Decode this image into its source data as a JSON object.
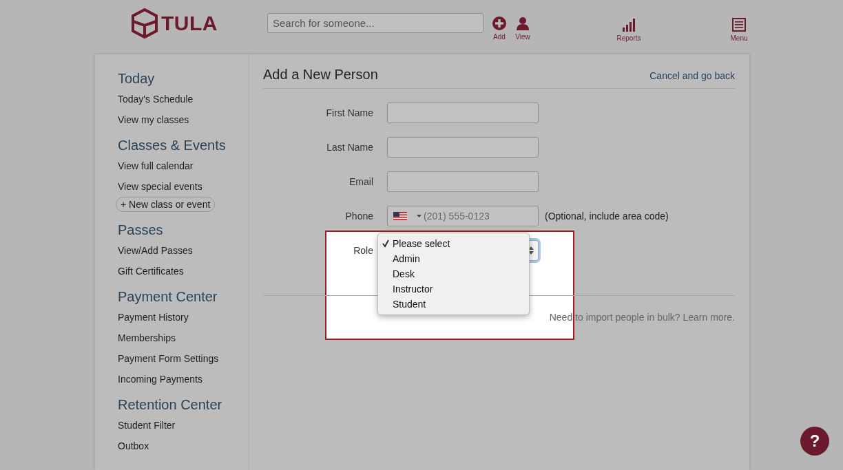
{
  "header": {
    "logo_text": "TULA",
    "search": {
      "placeholder": "Search for someone..."
    },
    "nav": [
      {
        "kind": "add",
        "label": "Add"
      },
      {
        "kind": "view",
        "label": "View"
      },
      {
        "kind": "reports",
        "label": "Reports"
      },
      {
        "kind": "menu",
        "label": "Menu"
      }
    ]
  },
  "sidebar": [
    {
      "title": "Today",
      "items": [
        {
          "kind": "link",
          "label": "Today's Schedule"
        },
        {
          "kind": "link",
          "label": "View my classes"
        }
      ]
    },
    {
      "title": "Classes & Events",
      "items": [
        {
          "kind": "link",
          "label": "View full calendar"
        },
        {
          "kind": "link",
          "label": "View special events"
        },
        {
          "kind": "button",
          "label": "+ New class or event"
        }
      ]
    },
    {
      "title": "Passes",
      "items": [
        {
          "kind": "link",
          "label": "View/Add Passes"
        },
        {
          "kind": "link",
          "label": "Gift Certificates"
        }
      ]
    },
    {
      "title": "Payment Center",
      "items": [
        {
          "kind": "link",
          "label": "Payment History"
        },
        {
          "kind": "link",
          "label": "Memberships"
        },
        {
          "kind": "link",
          "label": "Payment Form Settings"
        },
        {
          "kind": "link",
          "label": "Incoming Payments"
        }
      ]
    },
    {
      "title": "Retention Center",
      "items": [
        {
          "kind": "link",
          "label": "Student Filter"
        },
        {
          "kind": "link",
          "label": "Outbox"
        }
      ]
    }
  ],
  "form": {
    "title": "Add a New Person",
    "cancel_link": "Cancel and go back",
    "fields": [
      {
        "kind": "text",
        "label": "First Name",
        "highlighted": false
      },
      {
        "kind": "text",
        "label": "Last Name",
        "highlighted": false
      },
      {
        "kind": "text",
        "label": "Email",
        "highlighted": false
      },
      {
        "kind": "phone",
        "label": "Phone",
        "placeholder": "(201) 555-0123",
        "hint": "(Optional, include area code)",
        "highlighted": false
      },
      {
        "kind": "select",
        "label": "Role",
        "open": true,
        "highlighted": true,
        "options": [
          {
            "label": "Please select",
            "selected": true
          },
          {
            "label": "Admin",
            "selected": false
          },
          {
            "label": "Desk",
            "selected": false
          },
          {
            "label": "Instructor",
            "selected": false
          },
          {
            "label": "Student",
            "selected": false
          }
        ]
      }
    ],
    "import_note": "Need to import people in bulk? Learn more."
  },
  "help_button": "?"
}
